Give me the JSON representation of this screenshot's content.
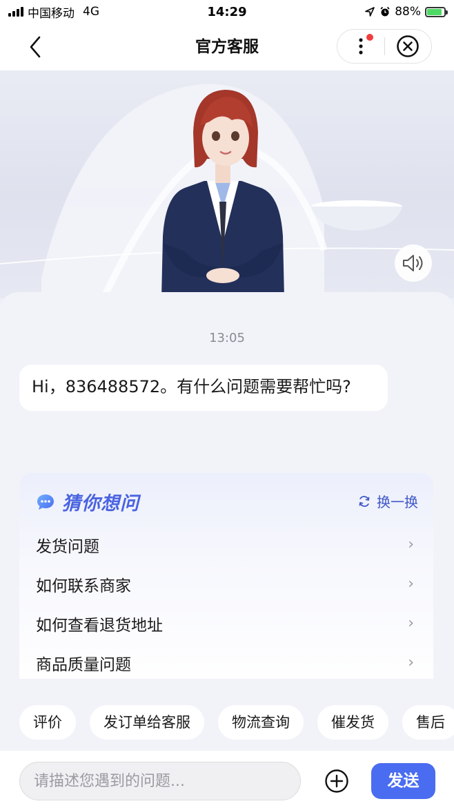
{
  "status_bar": {
    "carrier": "中国移动",
    "network": "4G",
    "time": "14:29",
    "battery_percent": "88%",
    "battery_level": 0.88
  },
  "nav": {
    "title": "官方客服"
  },
  "chat": {
    "timestamp": "13:05",
    "greeting": "Hi，836488572。有什么问题需要帮忙吗?"
  },
  "guess": {
    "title": "猜你想问",
    "refresh_label": "换一换",
    "items": [
      {
        "label": "发货问题"
      },
      {
        "label": "如何联系商家"
      },
      {
        "label": "如何查看退货地址"
      },
      {
        "label": "商品质量问题"
      }
    ]
  },
  "quick_chips": [
    {
      "label": "评价"
    },
    {
      "label": "发订单给客服"
    },
    {
      "label": "物流查询"
    },
    {
      "label": "催发货"
    },
    {
      "label": "售后"
    }
  ],
  "input": {
    "placeholder": "请描述您遇到的问题...",
    "value": "",
    "send_label": "发送"
  },
  "colors": {
    "accent": "#4a6cf0",
    "guess_title": "#4a63e0",
    "notification_dot": "#f23d3d",
    "battery_fill": "#4cd964"
  }
}
